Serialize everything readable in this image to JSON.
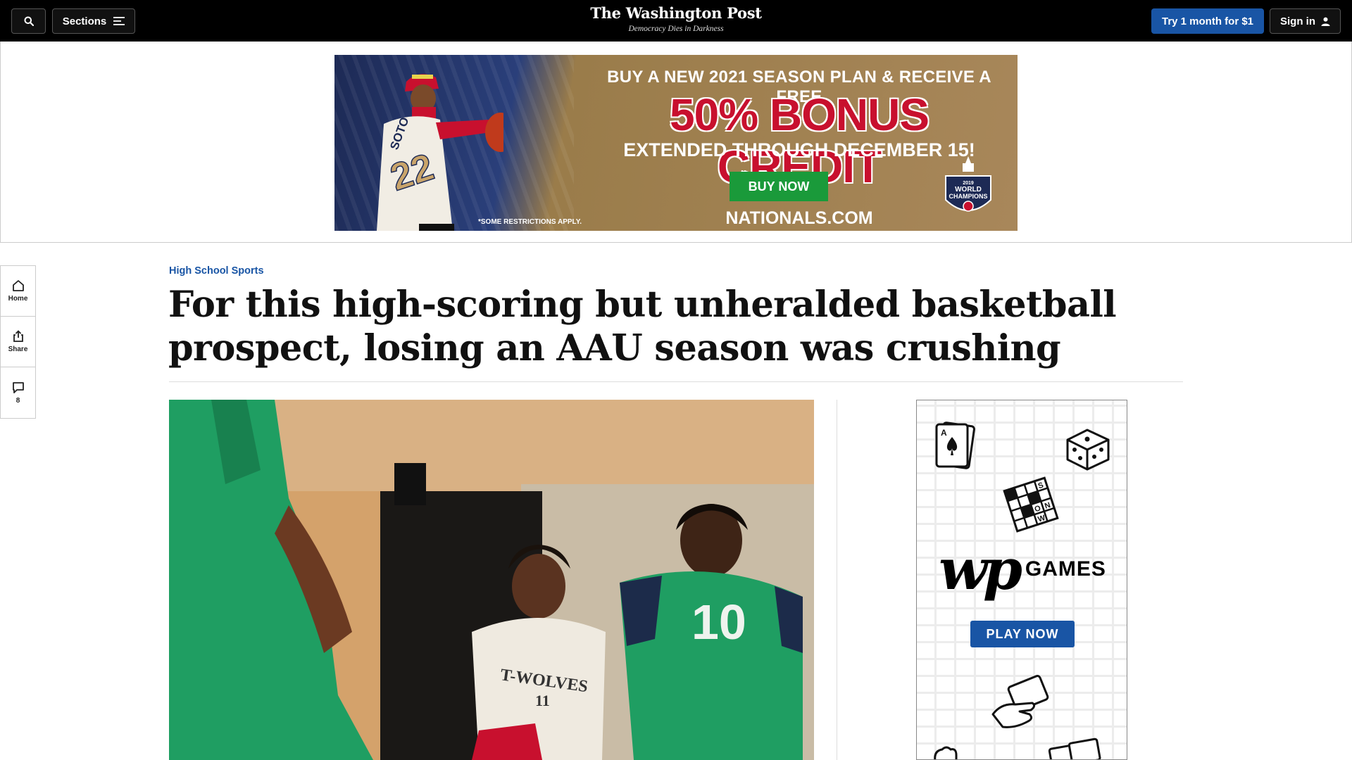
{
  "header": {
    "logo": "The Washington Post",
    "tagline": "Democracy Dies in Darkness",
    "search_icon": "search-icon",
    "sections_label": "Sections",
    "try_label": "Try 1 month for $1",
    "signin_label": "Sign in",
    "colors": {
      "bar": "#000000",
      "accent": "#1955a5"
    }
  },
  "banner_ad": {
    "line1": "BUY A NEW 2021 SEASON PLAN & RECEIVE A FREE",
    "line2": "50% BONUS CREDIT",
    "line3": "EXTENDED THROUGH DECEMBER 15!",
    "button": "BUY NOW",
    "site": "NATIONALS.COM",
    "note": "*SOME RESTRICTIONS APPLY.",
    "badge_year": "2019",
    "badge_line1": "WORLD",
    "badge_line2": "CHAMPIONS",
    "jersey_name": "SOTO",
    "jersey_number": "22"
  },
  "rail": {
    "home": "Home",
    "share": "Share",
    "comments_count": "8"
  },
  "article": {
    "kicker": "High School Sports",
    "headline": "For this high-scoring but unheralded basketball prospect, losing an AAU season was crushing",
    "photo": {
      "jersey_left_text": "T-WOLVES",
      "jersey_left_number": "11",
      "jersey_right_number": "10"
    }
  },
  "games_ad": {
    "logo": "wp",
    "label": "GAMES",
    "button": "PLAY NOW",
    "crossword_letters": [
      "S",
      "N",
      "O",
      "W"
    ],
    "card_rank": "A"
  }
}
